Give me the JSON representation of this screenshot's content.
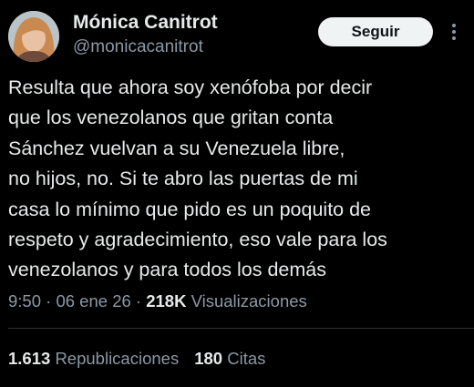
{
  "author": {
    "name": "Mónica Canitrot",
    "handle": "@monicacanitrot"
  },
  "follow_button": {
    "label": "Seguir"
  },
  "more_icon": "vertical-ellipsis-icon",
  "tweet": {
    "text": "Resulta que ahora soy xenófoba por decir\nque los venezolanos que gritan conta\nSánchez vuelvan a su Venezuela libre,\nno hijos, no. Si te abro las puertas de mi\ncasa lo mínimo que pido es un poquito de\nrespeto y agradecimiento, eso vale para los\nvenezolanos y para todos los demás",
    "time": "9:50",
    "date": "06 ene 26",
    "separator": "·",
    "views_count": "218K",
    "views_label": "Visualizaciones"
  },
  "stats": {
    "reposts_count": "1.613",
    "reposts_label": "Republicaciones",
    "quotes_count": "180",
    "quotes_label": "Citas"
  },
  "colors": {
    "background": "#000000",
    "primary_text": "#e7e9ea",
    "secondary_text": "#8b98a5",
    "button_bg": "#eff3f4",
    "divider": "#2f3336"
  }
}
